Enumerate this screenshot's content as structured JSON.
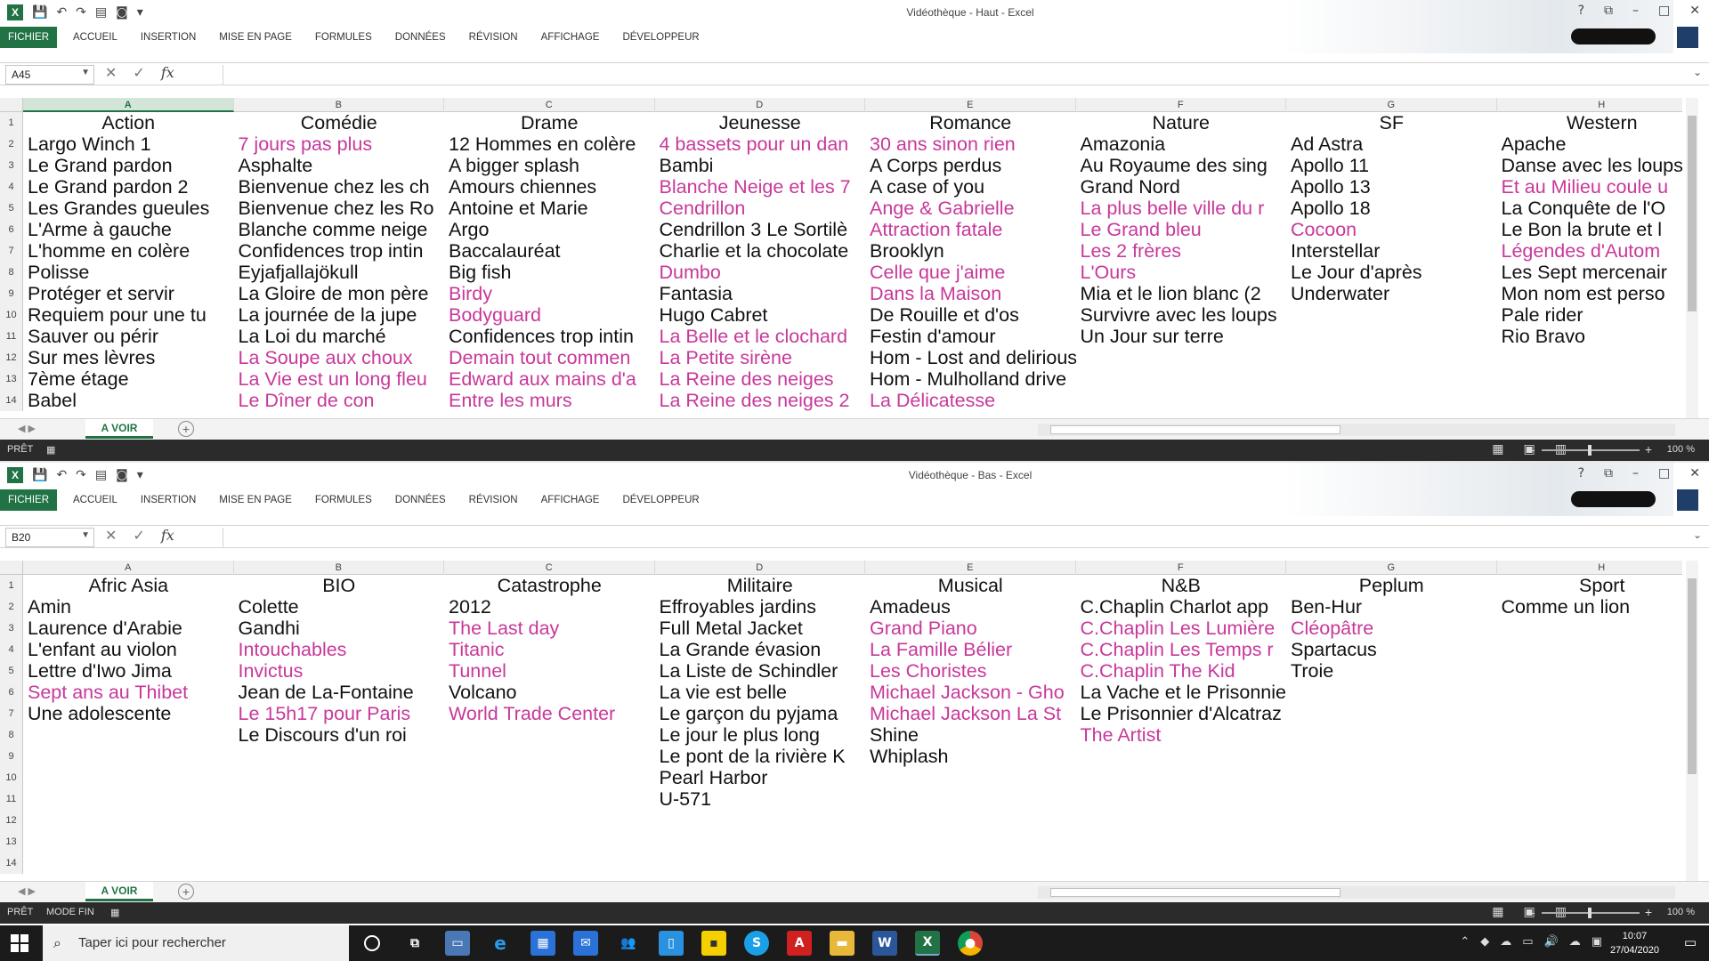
{
  "colors": {
    "excel_green": "#217346",
    "pink_text": "#c8389a",
    "status_bg": "#2b2b2b",
    "taskbar_bg": "#1b1b1b"
  },
  "ribbon_tabs": [
    "FICHIER",
    "ACCUEIL",
    "INSERTION",
    "MISE EN PAGE",
    "FORMULES",
    "DONNÉES",
    "RÉVISION",
    "AFFICHAGE",
    "DÉVELOPPEUR"
  ],
  "column_letters": [
    "A",
    "B",
    "C",
    "D",
    "E",
    "F",
    "G",
    "H"
  ],
  "row_numbers": [
    "1",
    "2",
    "3",
    "4",
    "5",
    "6",
    "7",
    "8",
    "9",
    "10",
    "11",
    "12",
    "13",
    "14"
  ],
  "top": {
    "title": "Vidéothèque - Haut - Excel",
    "namebox": "A45",
    "sheet_tab": "A VOIR",
    "status": "PRÊT",
    "zoom": "100 %",
    "headers": [
      "Action",
      "Comédie",
      "Drame",
      "Jeunesse",
      "Romance",
      "Nature",
      "SF",
      "Western"
    ],
    "columns": [
      [
        [
          "Largo Winch 1",
          0
        ],
        [
          "Le Grand pardon",
          0
        ],
        [
          "Le Grand pardon 2",
          0
        ],
        [
          "Les Grandes gueules",
          0
        ],
        [
          "L'Arme à gauche",
          0
        ],
        [
          "L'homme en colère",
          0
        ],
        [
          "Polisse",
          0
        ],
        [
          "Protéger et servir",
          0
        ],
        [
          "Requiem pour une tu",
          0
        ],
        [
          "Sauver ou périr",
          0
        ],
        [
          "Sur mes lèvres",
          0
        ],
        [
          "7ème étage",
          0
        ],
        [
          "Babel",
          0
        ]
      ],
      [
        [
          "7 jours pas plus",
          1
        ],
        [
          "Asphalte",
          0
        ],
        [
          "Bienvenue chez les ch",
          0
        ],
        [
          "Bienvenue chez les Ro",
          0
        ],
        [
          "Blanche comme neige",
          0
        ],
        [
          "Confidences trop intin",
          0
        ],
        [
          "Eyjafjallajökull",
          0
        ],
        [
          "La Gloire de mon père",
          0
        ],
        [
          "La journée de la jupe",
          0
        ],
        [
          "La Loi du marché",
          0
        ],
        [
          "La Soupe aux choux",
          1
        ],
        [
          "La Vie est un long fleu",
          1
        ],
        [
          "Le Dîner de con",
          1
        ]
      ],
      [
        [
          "12 Hommes en colère",
          0
        ],
        [
          "A bigger splash",
          0
        ],
        [
          "Amours chiennes",
          0
        ],
        [
          "Antoine et Marie",
          0
        ],
        [
          "Argo",
          0
        ],
        [
          "Baccalauréat",
          0
        ],
        [
          "Big fish",
          0
        ],
        [
          "Birdy",
          1
        ],
        [
          "Bodyguard",
          1
        ],
        [
          "Confidences trop intin",
          0
        ],
        [
          "Demain tout commen",
          1
        ],
        [
          "Edward aux mains d'a",
          1
        ],
        [
          "Entre les murs",
          1
        ]
      ],
      [
        [
          "4 bassets pour un dan",
          1
        ],
        [
          "Bambi",
          0
        ],
        [
          "Blanche Neige et les 7",
          1
        ],
        [
          "Cendrillon",
          1
        ],
        [
          "Cendrillon 3 Le Sortilè",
          0
        ],
        [
          "Charlie et la chocolate",
          0
        ],
        [
          "Dumbo",
          1
        ],
        [
          "Fantasia",
          0
        ],
        [
          "Hugo Cabret",
          0
        ],
        [
          "La Belle et le clochard",
          1
        ],
        [
          "La Petite sirène",
          1
        ],
        [
          "La Reine des neiges",
          1
        ],
        [
          "La Reine des neiges 2",
          1
        ]
      ],
      [
        [
          "30 ans sinon rien",
          1
        ],
        [
          "A Corps perdus",
          0
        ],
        [
          "A case of you",
          0
        ],
        [
          "Ange & Gabrielle",
          1
        ],
        [
          "Attraction fatale",
          1
        ],
        [
          "Brooklyn",
          0
        ],
        [
          "Celle que j'aime",
          1
        ],
        [
          "Dans la Maison",
          1
        ],
        [
          "De Rouille et d'os",
          0
        ],
        [
          "Festin d'amour",
          0
        ],
        [
          "Hom - Lost and delirious",
          0
        ],
        [
          "Hom - Mulholland drive",
          0
        ],
        [
          "La Délicatesse",
          1
        ]
      ],
      [
        [
          "Amazonia",
          0
        ],
        [
          "Au Royaume des sing",
          0
        ],
        [
          "Grand Nord",
          0
        ],
        [
          "La plus belle ville du r",
          1
        ],
        [
          "Le Grand bleu",
          1
        ],
        [
          "Les 2 frères",
          1
        ],
        [
          "L'Ours",
          1
        ],
        [
          "Mia et le lion blanc (2",
          0
        ],
        [
          "Survivre avec les loups",
          0
        ],
        [
          "Un Jour sur terre",
          0
        ]
      ],
      [
        [
          "Ad Astra",
          0
        ],
        [
          "Apollo 11",
          0
        ],
        [
          "Apollo  13",
          0
        ],
        [
          "Apollo 18",
          0
        ],
        [
          "Cocoon",
          1
        ],
        [
          "Interstellar",
          0
        ],
        [
          "Le Jour d'après",
          0
        ],
        [
          "Underwater",
          0
        ]
      ],
      [
        [
          "Apache",
          0
        ],
        [
          "Danse avec les loups",
          0
        ],
        [
          "Et au Milieu coule u",
          1
        ],
        [
          "La Conquête de l'O",
          0
        ],
        [
          "Le Bon la brute et l",
          0
        ],
        [
          "Légendes d'Autom",
          1
        ],
        [
          "Les Sept mercenair",
          0
        ],
        [
          "Mon nom est perso",
          0
        ],
        [
          "Pale rider",
          0
        ],
        [
          "Rio Bravo",
          0
        ]
      ]
    ]
  },
  "bottom": {
    "title": "Vidéothèque - Bas - Excel",
    "namebox": "B20",
    "sheet_tab": "A VOIR",
    "status": "PRÊT",
    "status2": "MODE FIN",
    "zoom": "100 %",
    "headers": [
      "Afric Asia",
      "BIO",
      "Catastrophe",
      "Militaire",
      "Musical",
      "N&B",
      "Peplum",
      "Sport"
    ],
    "columns": [
      [
        [
          "Amin",
          0
        ],
        [
          "Laurence d'Arabie",
          0
        ],
        [
          "L'enfant au violon",
          0
        ],
        [
          "Lettre d'Iwo Jima",
          0
        ],
        [
          "Sept ans au Thibet",
          1
        ],
        [
          "Une adolescente",
          0
        ]
      ],
      [
        [
          "Colette",
          0
        ],
        [
          "Gandhi",
          0
        ],
        [
          "Intouchables",
          1
        ],
        [
          "Invictus",
          1
        ],
        [
          "Jean de La-Fontaine",
          0
        ],
        [
          "Le 15h17 pour Paris",
          1
        ],
        [
          "Le Discours d'un roi",
          0
        ]
      ],
      [
        [
          "2012",
          0
        ],
        [
          "The Last day",
          1
        ],
        [
          "Titanic",
          1
        ],
        [
          "Tunnel",
          1
        ],
        [
          "Volcano",
          0
        ],
        [
          "World Trade Center",
          1
        ]
      ],
      [
        [
          "Effroyables jardins",
          0
        ],
        [
          "Full Metal Jacket",
          0
        ],
        [
          "La Grande évasion",
          0
        ],
        [
          "La Liste de Schindler",
          0
        ],
        [
          "La vie est belle",
          0
        ],
        [
          "Le garçon du pyjama",
          0
        ],
        [
          "Le jour le plus long",
          0
        ],
        [
          "Le pont de la rivière K",
          0
        ],
        [
          "Pearl Harbor",
          0
        ],
        [
          "U-571",
          0
        ]
      ],
      [
        [
          "Amadeus",
          0
        ],
        [
          "Grand Piano",
          1
        ],
        [
          "La Famille Bélier",
          1
        ],
        [
          "Les Choristes",
          1
        ],
        [
          "Michael Jackson - Gho",
          1
        ],
        [
          "Michael Jackson La St",
          1
        ],
        [
          "Shine",
          0
        ],
        [
          "Whiplash",
          0
        ]
      ],
      [
        [
          "C.Chaplin Charlot app",
          0
        ],
        [
          "C.Chaplin Les Lumière",
          1
        ],
        [
          "C.Chaplin Les Temps r",
          1
        ],
        [
          "C.Chaplin The Kid",
          1
        ],
        [
          "La Vache et le Prisonnier",
          0
        ],
        [
          "Le Prisonnier d'Alcatraz",
          0
        ],
        [
          "The Artist",
          1
        ]
      ],
      [
        [
          "Ben-Hur",
          0
        ],
        [
          "Cléopâtre",
          1
        ],
        [
          "Spartacus",
          0
        ],
        [
          "Troie",
          0
        ]
      ],
      [
        [
          "Comme un lion",
          0
        ]
      ]
    ]
  },
  "taskbar": {
    "search_placeholder": "Taper ici pour rechercher",
    "time": "10:07",
    "date": "27/04/2020"
  }
}
